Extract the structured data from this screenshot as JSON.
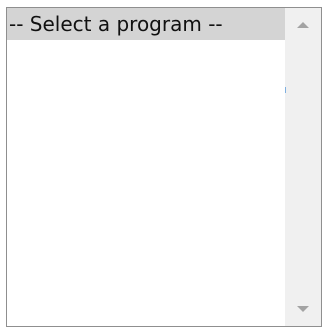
{
  "listbox": {
    "options": [
      {
        "label": "-- Select a program --",
        "selected": true
      }
    ]
  },
  "scrollbar": {
    "up_icon": "triangle-up-icon",
    "down_icon": "triangle-down-icon"
  },
  "colors": {
    "selected_bg": "#d4d4d4",
    "border": "#8f8f8f",
    "scrollbar_track": "#f0f0f0",
    "arrow": "#a3a3a3"
  }
}
